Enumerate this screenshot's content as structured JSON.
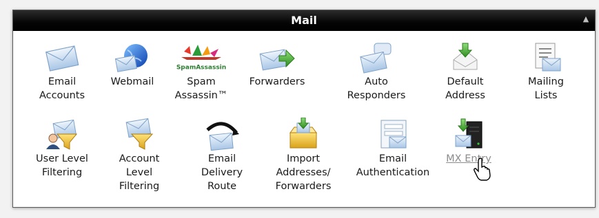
{
  "panel": {
    "title": "Mail",
    "collapse_icon": "chevron-up-icon",
    "items": [
      {
        "label": "Email\nAccounts",
        "icon": "envelope-icon"
      },
      {
        "label": "Webmail",
        "icon": "globe-envelope-icon"
      },
      {
        "label": "Spam\nAssassin™",
        "icon": "spamassassin-logo-icon",
        "logo_text": "SpamAssassin"
      },
      {
        "label": "Forwarders",
        "icon": "envelope-arrow-icon"
      },
      {
        "label": "Auto\nResponders",
        "icon": "envelope-bubble-icon"
      },
      {
        "label": "Default\nAddress",
        "icon": "envelope-download-icon"
      },
      {
        "label": "Mailing\nLists",
        "icon": "list-envelope-icon"
      },
      {
        "label": "User Level\nFiltering",
        "icon": "user-funnel-icon"
      },
      {
        "label": "Account\nLevel\nFiltering",
        "icon": "envelope-funnel-icon"
      },
      {
        "label": "Email\nDelivery\nRoute",
        "icon": "envelope-route-icon"
      },
      {
        "label": "Import\nAddresses/\nForwarders",
        "icon": "box-import-icon"
      },
      {
        "label": "Email\nAuthentication",
        "icon": "envelope-form-icon"
      },
      {
        "label": "MX Entry",
        "icon": "server-envelope-icon"
      }
    ]
  },
  "cursor": {
    "icon": "hand-pointer-icon"
  }
}
